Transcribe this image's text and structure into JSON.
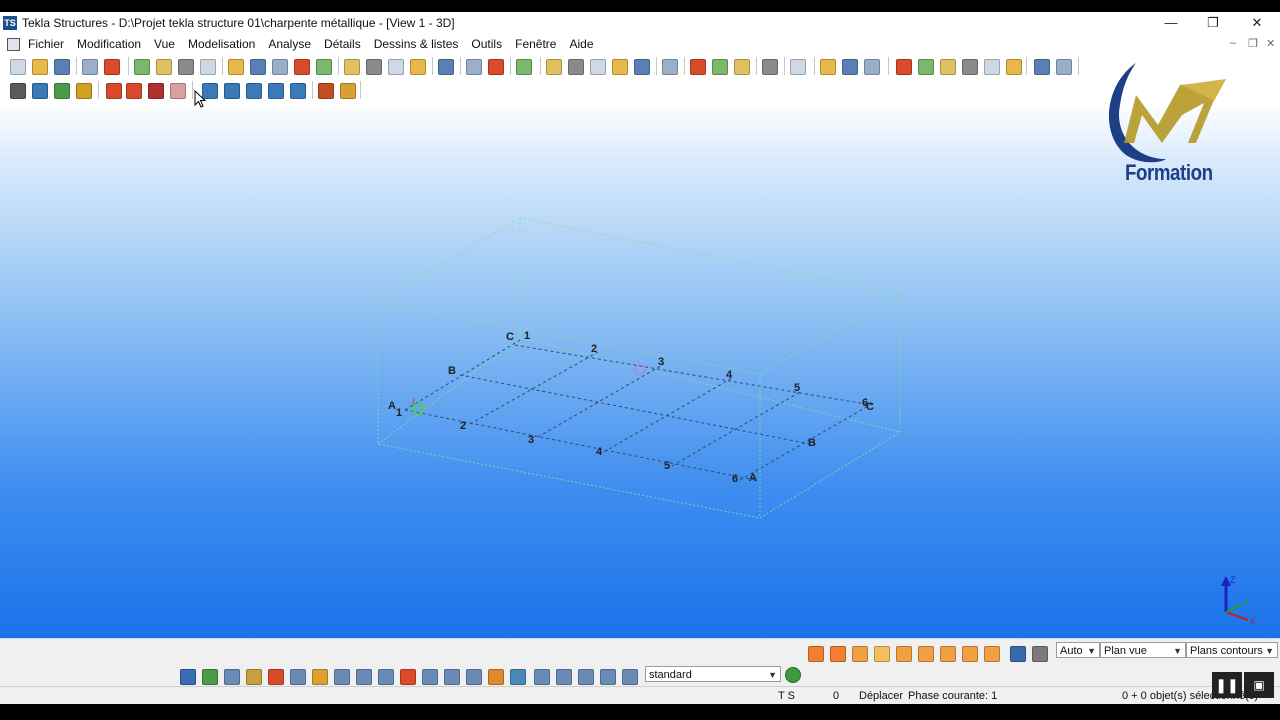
{
  "window": {
    "title": "Tekla Structures - D:\\Projet tekla structure 01\\charpente métallique - [View 1 - 3D]",
    "app_icon": "tekla-icon",
    "controls": [
      "minimize-icon",
      "restore-icon",
      "close-icon"
    ]
  },
  "menu": {
    "items": [
      "Fichier",
      "Modification",
      "Vue",
      "Modelisation",
      "Analyse",
      "Détails",
      "Dessins & listes",
      "Outils",
      "Fenêtre",
      "Aide"
    ]
  },
  "logo": {
    "text": "Formation",
    "colors": {
      "m_gold": "#b59a2a",
      "arc_blue": "#1d3f86"
    }
  },
  "grid": {
    "labels_front": [
      "1",
      "2",
      "3",
      "4",
      "5",
      "6"
    ],
    "labels_back": [
      "1",
      "2",
      "3",
      "4",
      "5",
      "6"
    ],
    "labels_rows_left": [
      "A",
      "B",
      "C"
    ],
    "labels_rows_right": [
      "A",
      "B",
      "C"
    ]
  },
  "bottom_panel": {
    "auto_select": "Auto",
    "plan_select": "Plan vue",
    "contour_select": "Plans contours",
    "filter_select": "standard"
  },
  "status": {
    "ts": "T S",
    "zero": "0",
    "mode": "Déplacer",
    "phase": "Phase courante: 1",
    "selection": "0 + 0 objet(s) sélectionné(s)"
  },
  "colors": {
    "viewport_top": "#ffffff",
    "viewport_bottom": "#1a73ea",
    "work_area": "#7fe0a0",
    "grid_line": "#2b4a7a"
  }
}
